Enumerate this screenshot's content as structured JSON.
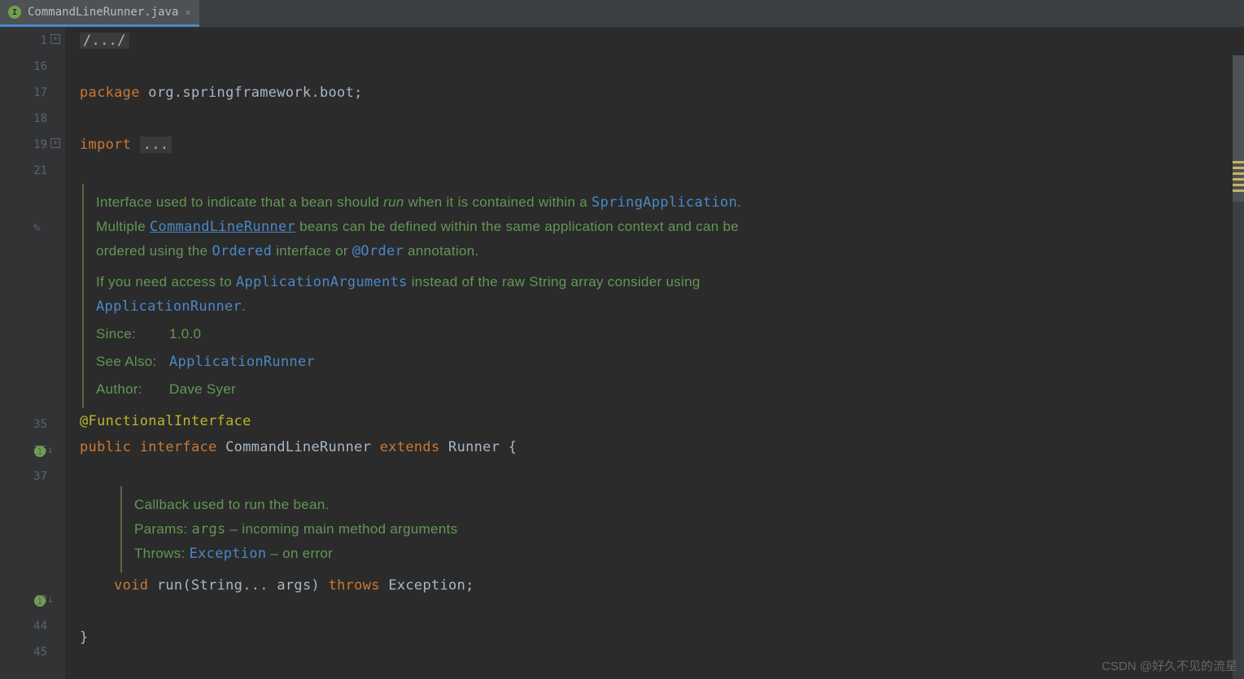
{
  "tab": {
    "name": "CommandLineRunner.java"
  },
  "gutter_lines": [
    "1",
    "16",
    "17",
    "18",
    "19",
    "21"
  ],
  "gutter_lines_2": [
    "35",
    "36",
    "37"
  ],
  "gutter_lines_3": [
    "43",
    "44",
    "45"
  ],
  "code": {
    "fold_comment": "/.../",
    "package_kw": "package ",
    "package_name": "org.springframework.boot",
    "import_kw": "import ",
    "import_fold": "...",
    "annotation": "@FunctionalInterface",
    "decl_public": "public ",
    "decl_interface": "interface ",
    "decl_name": "CommandLineRunner ",
    "decl_extends": "extends ",
    "decl_super": "Runner ",
    "decl_open": "{",
    "method_indent": "    ",
    "method_void": "void ",
    "method_name": "run",
    "method_params_open": "(",
    "method_param_type": "String",
    "method_varargs": "... args) ",
    "method_throws": "throws ",
    "method_exc": "Exception",
    "method_end": ";",
    "close_brace": "}"
  },
  "doc1": {
    "l1a": "Interface used to indicate that a bean should ",
    "l1b": "run",
    "l1c": " when it is contained within a ",
    "l1d": "SpringApplication",
    "l1e": ".",
    "l2a": "Multiple ",
    "l2b": "CommandLineRunner",
    "l2c": " beans can be defined within the same application context and can be",
    "l3a": "ordered using the ",
    "l3b": "Ordered",
    "l3c": " interface or ",
    "l3d": "@Order",
    "l3e": " annotation.",
    "l4a": "If you need access to ",
    "l4b": "ApplicationArguments",
    "l4c": " instead of the raw String array consider using",
    "l5a": "ApplicationRunner",
    "l5b": ".",
    "since_label": "Since:",
    "since_val": "1.0.0",
    "seealso_label": "See Also:",
    "seealso_val": "ApplicationRunner",
    "author_label": "Author:",
    "author_val": "Dave Syer"
  },
  "doc2": {
    "l1": "Callback used to run the bean.",
    "params_label": "Params:",
    "params_arg": "args",
    "params_desc": " – incoming main method arguments",
    "throws_label": "Throws:",
    "throws_type": "Exception",
    "throws_desc": " – on error"
  },
  "watermark": "CSDN @好久不见的流星"
}
